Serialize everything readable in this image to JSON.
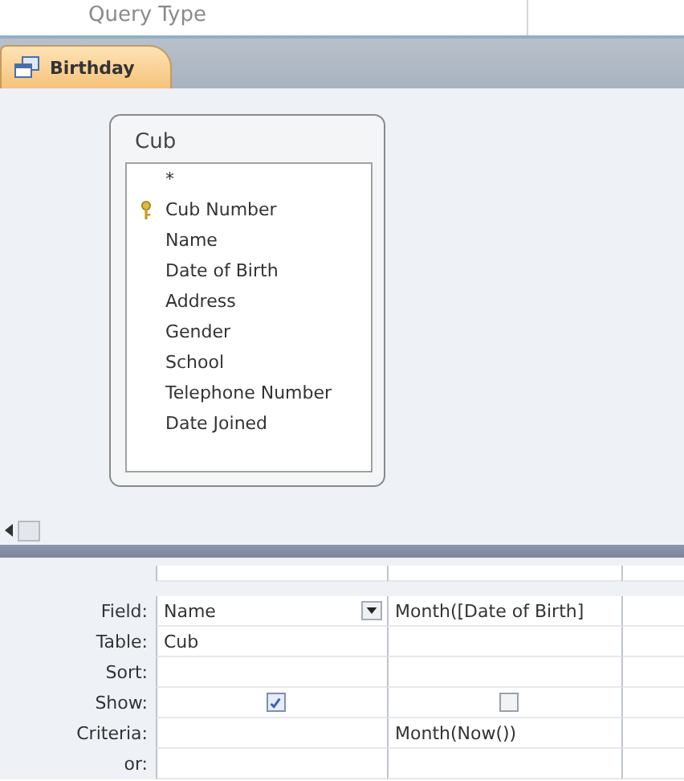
{
  "ribbon": {
    "group_label": "Query Type"
  },
  "tabs": [
    {
      "label": "Birthday",
      "selected": true
    }
  ],
  "table": {
    "title": "Cub",
    "fields": [
      {
        "name": "*",
        "primary_key": false
      },
      {
        "name": "Cub Number",
        "primary_key": true
      },
      {
        "name": "Name",
        "primary_key": false
      },
      {
        "name": "Date of Birth",
        "primary_key": false
      },
      {
        "name": "Address",
        "primary_key": false
      },
      {
        "name": "Gender",
        "primary_key": false
      },
      {
        "name": "School",
        "primary_key": false
      },
      {
        "name": "Telephone Number",
        "primary_key": false
      },
      {
        "name": "Date Joined",
        "primary_key": false
      }
    ]
  },
  "grid": {
    "row_labels": [
      "Field:",
      "Table:",
      "Sort:",
      "Show:",
      "Criteria:",
      "or:"
    ],
    "columns": [
      {
        "field": "Name",
        "dropdown": true,
        "table": "Cub",
        "show": true
      },
      {
        "field": "Month([Date of Birth]",
        "dropdown": false,
        "show": false,
        "criteria": "Month(Now())"
      }
    ]
  }
}
